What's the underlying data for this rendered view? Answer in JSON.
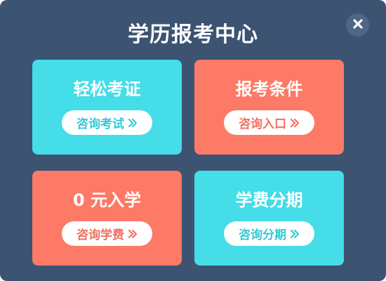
{
  "dialog": {
    "title": "学历报考中心",
    "close_label": "X"
  },
  "cards": [
    {
      "title": "轻松考证",
      "button_label": "咨询考试",
      "color": "#44dde8",
      "icon": "double-chevron-right-icon"
    },
    {
      "title": "报考条件",
      "button_label": "咨询入口",
      "color": "#fd7a67",
      "icon": "double-chevron-right-icon"
    },
    {
      "title": "0 元入学",
      "button_label": "咨询学费",
      "color": "#fd7a67",
      "icon": "double-chevron-right-icon"
    },
    {
      "title": "学费分期",
      "button_label": "咨询分期",
      "color": "#44dde8",
      "icon": "double-chevron-right-icon"
    }
  ],
  "colors": {
    "background": "#3c5372",
    "cyan": "#44dde8",
    "coral": "#fd7a67",
    "close_button": "#4f6685"
  }
}
